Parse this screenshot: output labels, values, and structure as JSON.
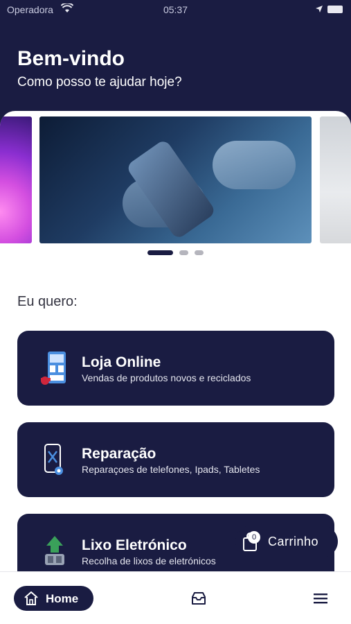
{
  "status_bar": {
    "carrier": "Operadora",
    "time": "05:37",
    "icons": [
      "wifi-icon",
      "location-arrow-icon",
      "battery-icon"
    ]
  },
  "header": {
    "title": "Bem-vindo",
    "subtitle": "Como posso te ajudar hoje?"
  },
  "carousel": {
    "slide_count": 3,
    "active_index": 0
  },
  "section": {
    "label": "Eu quero:"
  },
  "options": [
    {
      "title": "Loja Online",
      "subtitle": "Vendas de produtos novos e reciclados",
      "icon": "online-store-icon"
    },
    {
      "title": "Reparação",
      "subtitle": "Reparaçoes de telefones, Ipads, Tabletes",
      "icon": "phone-repair-icon"
    },
    {
      "title": "Lixo Eletrónico",
      "subtitle": "Recolha de lixos de eletrónicos",
      "icon": "e-waste-recycling-icon"
    }
  ],
  "cart": {
    "label": "Carrinho",
    "count": "0"
  },
  "bottom_nav": {
    "home_label": "Home",
    "items": [
      "home-icon",
      "inbox-icon",
      "menu-icon"
    ]
  },
  "colors": {
    "primary": "#1a1c42",
    "background": "#ffffff",
    "text": "#333340"
  }
}
